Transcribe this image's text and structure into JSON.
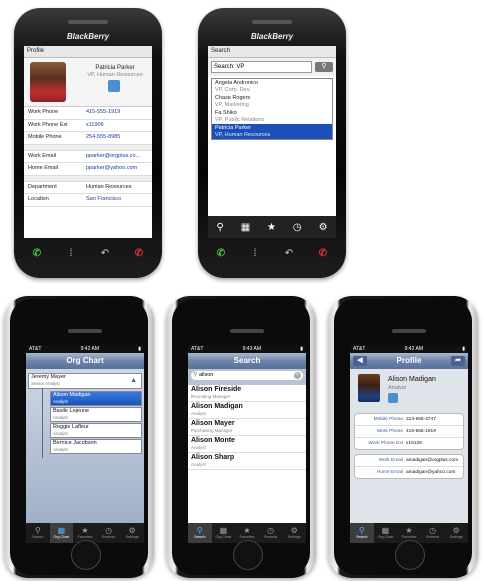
{
  "bb_profile": {
    "brand": "BlackBerry",
    "header": "Profile",
    "name": "Patricia Parker",
    "title": "VP, Human Resources",
    "rows_a": [
      {
        "label": "Work Phone",
        "value": "415-555-1919"
      },
      {
        "label": "Work Phone Ext",
        "value": "x11906"
      },
      {
        "label": "Mobile Phone",
        "value": "254-555-8985"
      }
    ],
    "rows_b": [
      {
        "label": "Work Email",
        "value": "pparker@orgplus.co..."
      },
      {
        "label": "Home Email",
        "value": "pparker@yahoo.com"
      }
    ],
    "rows_c": [
      {
        "label": "Department",
        "value": "Human Resources"
      },
      {
        "label": "Location",
        "value": "San Francisco"
      }
    ]
  },
  "bb_search": {
    "brand": "BlackBerry",
    "header": "Search",
    "query": "Search: VP",
    "results": [
      {
        "name": "Angela Andronico",
        "title": "VP, Corp. Dev."
      },
      {
        "name": "Chase Rogers",
        "title": "VP, Marketing"
      },
      {
        "name": "Fa Shiko",
        "title": "VP, Public Relations"
      },
      {
        "name": "Patricia Parker",
        "title": "VP, Human Resources"
      }
    ]
  },
  "iphone_org": {
    "carrier": "AT&T",
    "time": "9:42 AM",
    "title": "Org Chart",
    "manager": {
      "name": "Jeremy Mayer",
      "title": "Senior Analyst"
    },
    "reports": [
      {
        "name": "Alison Madigan",
        "title": "Analyst"
      },
      {
        "name": "Basile Lejeune",
        "title": "Analyst"
      },
      {
        "name": "Reggie Lafleur",
        "title": "Analyst"
      },
      {
        "name": "Bernice Jacobson",
        "title": "Analyst"
      }
    ]
  },
  "iphone_search": {
    "carrier": "AT&T",
    "time": "9:43 AM",
    "title": "Search",
    "query": "alison",
    "results": [
      {
        "name": "Alison Fireside",
        "title": "Recruiting Manager"
      },
      {
        "name": "Alison Madigan",
        "title": "Analyst"
      },
      {
        "name": "Alison Mayer",
        "title": "Purchasing Manager"
      },
      {
        "name": "Alison Monte",
        "title": "Analyst"
      },
      {
        "name": "Alison Sharp",
        "title": "Analyst"
      }
    ]
  },
  "iphone_profile": {
    "carrier": "AT&T",
    "time": "9:42 AM",
    "title": "Profile",
    "name": "Alison Madigan",
    "job": "Analyst",
    "phones": [
      {
        "label": "Mobile Phone",
        "value": "313-555-4747"
      },
      {
        "label": "Work Phone",
        "value": "415-555-1919"
      },
      {
        "label": "Work Phone Ext",
        "value": "x16128"
      }
    ],
    "emails": [
      {
        "label": "Work Email",
        "value": "amadigan@orgplus.com"
      },
      {
        "label": "Home Email",
        "value": "amadigan@yahoo.com"
      }
    ]
  },
  "tabs": [
    "Search",
    "Org Chart",
    "Favorites",
    "Recents",
    "Settings"
  ]
}
